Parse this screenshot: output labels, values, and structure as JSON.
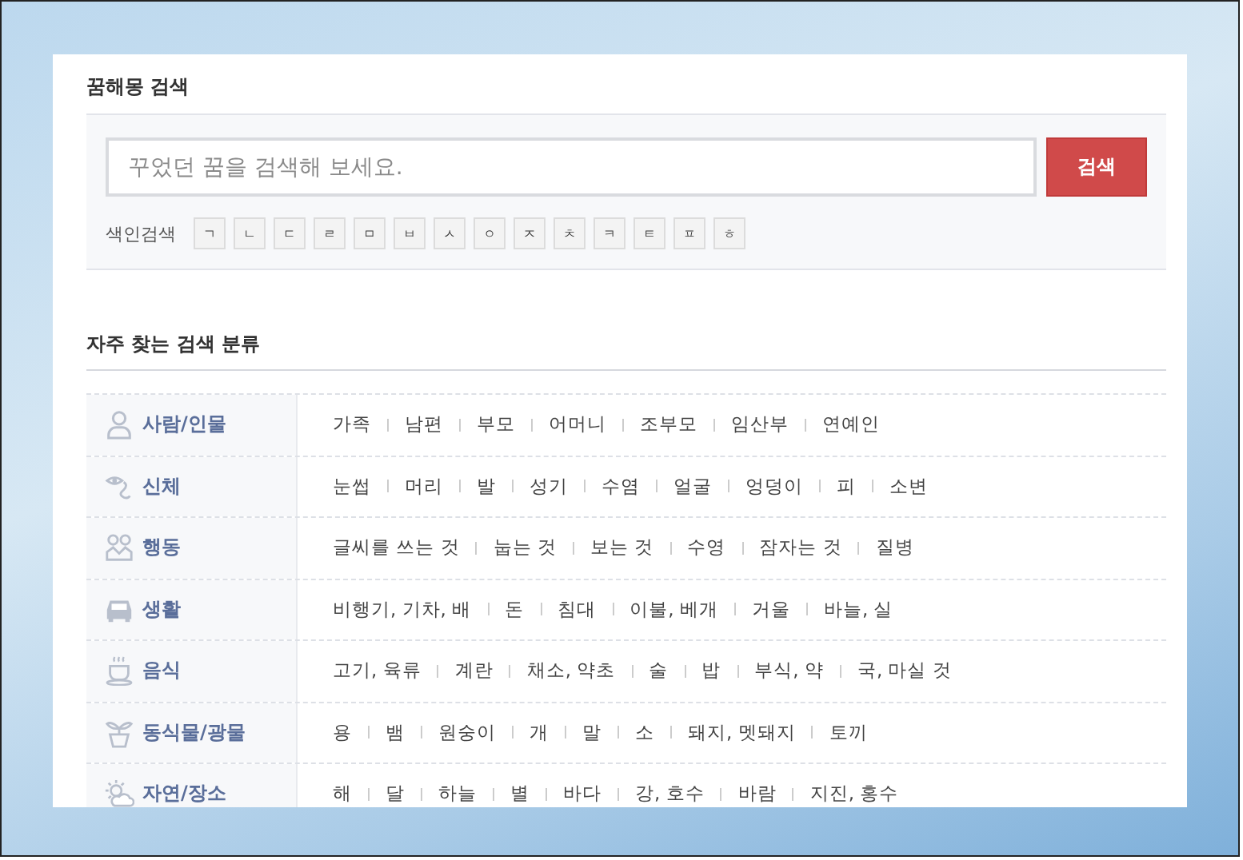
{
  "title": "꿈해몽 검색",
  "search": {
    "placeholder": "꾸었던 꿈을 검색해 보세요.",
    "button": "검색"
  },
  "index": {
    "label": "색인검색",
    "letters": [
      "ㄱ",
      "ㄴ",
      "ㄷ",
      "ㄹ",
      "ㅁ",
      "ㅂ",
      "ㅅ",
      "ㅇ",
      "ㅈ",
      "ㅊ",
      "ㅋ",
      "ㅌ",
      "ㅍ",
      "ㅎ"
    ]
  },
  "categories_title": "자주 찾는 검색 분류",
  "categories": [
    {
      "kind": "person",
      "name": "사람/인물",
      "items": [
        "가족",
        "남편",
        "부모",
        "어머니",
        "조부모",
        "임산부",
        "연예인"
      ]
    },
    {
      "kind": "body",
      "name": "신체",
      "items": [
        "눈썹",
        "머리",
        "발",
        "성기",
        "수염",
        "얼굴",
        "엉덩이",
        "피",
        "소변"
      ]
    },
    {
      "kind": "action",
      "name": "행동",
      "items": [
        "글씨를 쓰는 것",
        "눕는 것",
        "보는 것",
        "수영",
        "잠자는 것",
        "질병"
      ]
    },
    {
      "kind": "life",
      "name": "생활",
      "items": [
        "비행기, 기차, 배",
        "돈",
        "침대",
        "이불, 베개",
        "거울",
        "바늘, 실"
      ]
    },
    {
      "kind": "food",
      "name": "음식",
      "items": [
        "고기, 육류",
        "계란",
        "채소, 약초",
        "술",
        "밥",
        "부식, 약",
        "국, 마실 것"
      ]
    },
    {
      "kind": "nature",
      "name": "동식물/광물",
      "items": [
        "용",
        "뱀",
        "원숭이",
        "개",
        "말",
        "소",
        "돼지, 멧돼지",
        "토끼"
      ]
    },
    {
      "kind": "place",
      "name": "자연/장소",
      "items": [
        "해",
        "달",
        "하늘",
        "별",
        "바다",
        "강, 호수",
        "바람",
        "지진, 홍수"
      ]
    }
  ]
}
